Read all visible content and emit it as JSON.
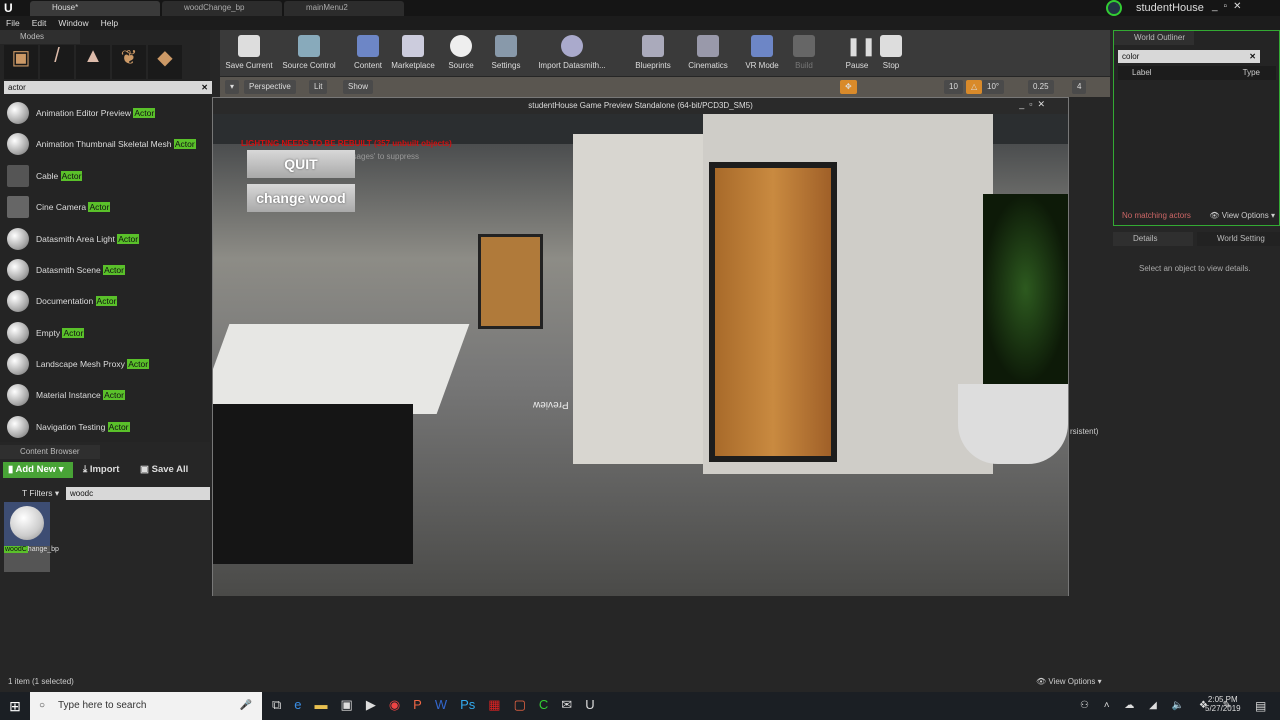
{
  "window": {
    "tabs": [
      {
        "label": "House*"
      },
      {
        "label": "woodChange_bp"
      },
      {
        "label": "mainMenu2"
      }
    ],
    "project": "studentHouse"
  },
  "menu": [
    "File",
    "Edit",
    "Window",
    "Help"
  ],
  "modes": {
    "title": "Modes",
    "search": "actor",
    "items": [
      {
        "name": "Animation Editor Preview ",
        "hl": "Actor"
      },
      {
        "name": "Animation Thumbnail Skeletal Mesh ",
        "hl": "Actor"
      },
      {
        "name": "Cable ",
        "hl": "Actor"
      },
      {
        "name": "Cine Camera ",
        "hl": "Actor"
      },
      {
        "name": "Datasmith Area Light ",
        "hl": "Actor"
      },
      {
        "name": "Datasmith Scene ",
        "hl": "Actor"
      },
      {
        "name": "Documentation ",
        "hl": "Actor"
      },
      {
        "name": "Empty ",
        "hl": "Actor"
      },
      {
        "name": "Landscape Mesh Proxy ",
        "hl": "Actor"
      },
      {
        "name": "Material Instance ",
        "hl": "Actor"
      },
      {
        "name": "Navigation Testing ",
        "hl": "Actor"
      }
    ]
  },
  "toolbar": [
    "Save Current",
    "Source Control",
    "Content",
    "Marketplace",
    "Source",
    "Settings",
    "Import Datasmith...",
    "Blueprints",
    "Cinematics",
    "VR Mode",
    "Build",
    "Pause",
    "Stop"
  ],
  "viewport": {
    "perspective": "Perspective",
    "lit": "Lit",
    "show": "Show",
    "grid": "10",
    "angle": "10°",
    "scale": "0.25",
    "cam": "4"
  },
  "game": {
    "title": "studentHouse Game Preview Standalone (64-bit/PCD3D_SM5)",
    "warning": "LIGHTING NEEDS TO BE REBUILT (357 unbuilt objects)",
    "suppress": "'DisableAllScreenMessages' to suppress",
    "quit": "QUIT",
    "change_wood": "change wood",
    "preview_text": "Preview"
  },
  "content_browser": {
    "title": "Content Browser",
    "add_new": "Add New",
    "import": "Import",
    "save_all": "Save All",
    "filters": "Filters",
    "search": "woodc",
    "asset_hl": "woodC",
    "asset_rest": "hange_bp",
    "status": "1 item (1 selected)",
    "view_options": "View Options"
  },
  "outliner": {
    "title": "World Outliner",
    "search": "color",
    "col_label": "Label",
    "col_type": "Type",
    "empty": "No matching actors",
    "view_options": "View Options",
    "persistent": "rsistent)"
  },
  "details": {
    "tab": "Details",
    "tab2": "World Setting",
    "empty": "Select an object to view details."
  },
  "taskbar": {
    "search": "Type here to search",
    "time": "2:05 PM",
    "date": "5/27/2019"
  }
}
